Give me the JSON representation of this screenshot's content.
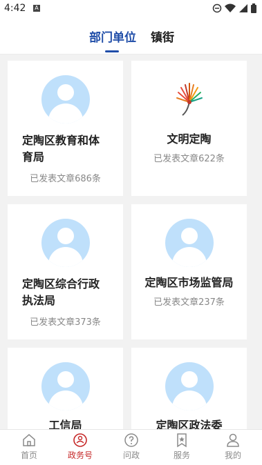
{
  "status_bar": {
    "time": "4:42",
    "notification_glyph": "A",
    "icons": [
      "dnd-icon",
      "wifi-icon",
      "signal-icon",
      "battery-icon"
    ]
  },
  "tabs": {
    "items": [
      {
        "label": "部门单位",
        "active": true
      },
      {
        "label": "镇街",
        "active": false
      }
    ],
    "active_color": "#1f4da8"
  },
  "cards": [
    {
      "name": "定陶区教育和体育局",
      "count_text": "已发表文章686条",
      "icon": "default-avatar-icon"
    },
    {
      "name": "文明定陶",
      "count_text": "已发表文章622条",
      "icon": "civilization-logo-icon"
    },
    {
      "name": "定陶区综合行政执法局",
      "count_text": "已发表文章373条",
      "icon": "default-avatar-icon"
    },
    {
      "name": "定陶区市场监管局",
      "count_text": "已发表文章237条",
      "icon": "default-avatar-icon"
    },
    {
      "name": "工信局",
      "icon": "default-avatar-icon"
    },
    {
      "name": "定陶区政法委",
      "icon": "default-avatar-icon"
    }
  ],
  "bottom_nav": {
    "items": [
      {
        "label": "首页",
        "icon": "home-icon",
        "active": false
      },
      {
        "label": "政务号",
        "icon": "gov-account-icon",
        "active": true
      },
      {
        "label": "问政",
        "icon": "question-icon",
        "active": false
      },
      {
        "label": "服务",
        "icon": "service-icon",
        "active": false
      },
      {
        "label": "我的",
        "icon": "profile-icon",
        "active": false
      }
    ],
    "active_color": "#c62828",
    "inactive_color": "#8a8a8a"
  }
}
